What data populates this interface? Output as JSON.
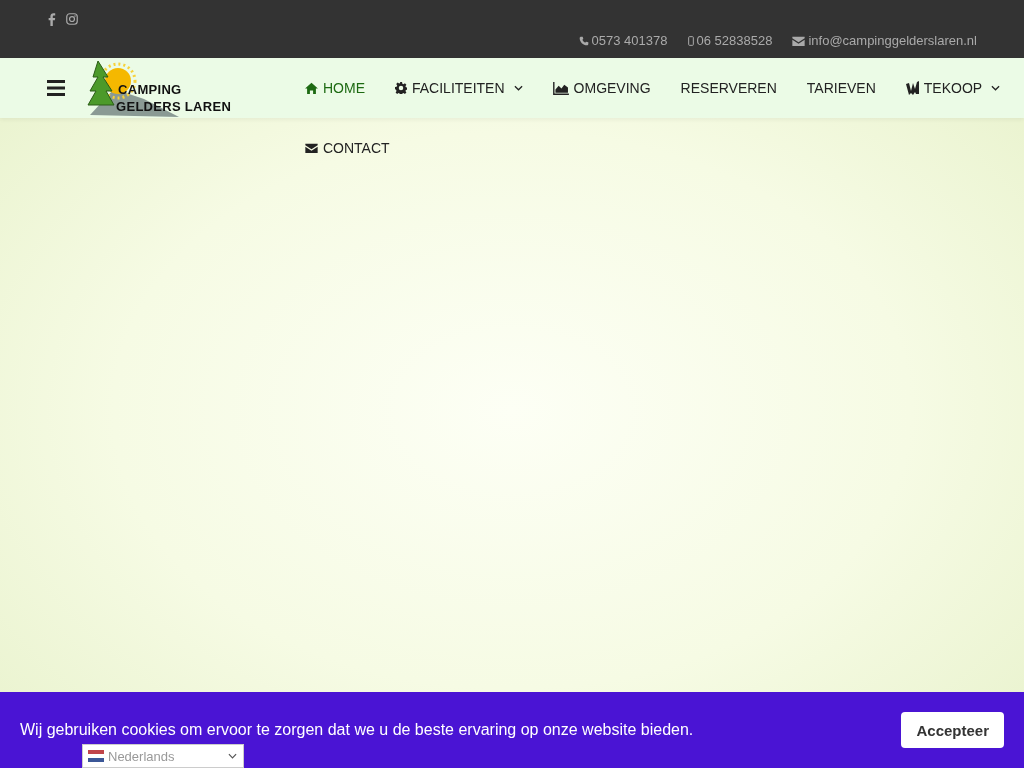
{
  "topbar": {
    "social": [
      {
        "kind": "facebook"
      },
      {
        "kind": "instagram"
      }
    ],
    "contacts": [
      {
        "kind": "phone",
        "text": "0573 401378"
      },
      {
        "kind": "mobile",
        "text": "06 52838528"
      },
      {
        "kind": "mail",
        "text": "info@campinggelderslaren.nl"
      }
    ]
  },
  "logo": {
    "lines": [
      "CAMPING",
      "GELDERS LAREN"
    ]
  },
  "nav": [
    {
      "label": "HOME",
      "kind": "home",
      "selected": true,
      "dropdown": false
    },
    {
      "label": "FACILITEITEN",
      "kind": "gear",
      "selected": false,
      "dropdown": true
    },
    {
      "label": "OMGEVING",
      "kind": "chart",
      "selected": false,
      "dropdown": false
    },
    {
      "label": "RESERVEREN",
      "kind": "plain",
      "selected": false,
      "dropdown": false
    },
    {
      "label": "TARIEVEN",
      "kind": "plain",
      "selected": false,
      "dropdown": false
    },
    {
      "label": "TEKOOP",
      "kind": "logo",
      "selected": false,
      "dropdown": true
    },
    {
      "label": "CONTACT",
      "kind": "mail",
      "selected": false,
      "dropdown": false
    }
  ],
  "cookie_bar": {
    "message": "Wij gebruiken cookies om ervoor te zorgen dat we u de beste ervaring op onze website bieden.",
    "button": "Accepteer"
  },
  "language_select": {
    "value": "Nederlands"
  }
}
